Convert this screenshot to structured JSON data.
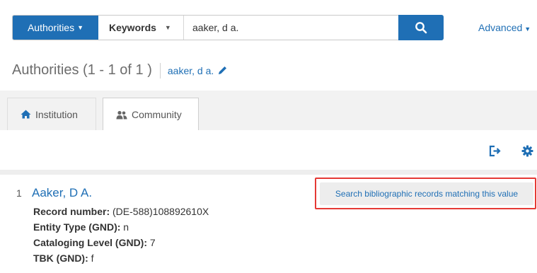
{
  "search": {
    "scope_label": "Authorities",
    "field_label": "Keywords",
    "query_value": "aaker, d a.",
    "advanced_label": "Advanced"
  },
  "results": {
    "title": "Authorities (1 - 1 of 1 )",
    "query_link": "aaker, d a."
  },
  "tabs": [
    {
      "label": "Institution",
      "icon": "home-icon",
      "active": false
    },
    {
      "label": "Community",
      "icon": "users-icon",
      "active": true
    }
  ],
  "toolbar": {
    "export_icon": "export-icon",
    "settings_icon": "gear-icon"
  },
  "records": [
    {
      "number": "1",
      "heading": "Aaker, D A.",
      "action_label": "Search bibliographic records matching this value",
      "fields": [
        {
          "label": "Record number:",
          "value": "(DE-588)108892610X"
        },
        {
          "label": "Entity Type (GND):",
          "value": "n"
        },
        {
          "label": "Cataloging Level (GND):",
          "value": "7"
        },
        {
          "label": "TBK (GND):",
          "value": "f"
        }
      ]
    }
  ],
  "colors": {
    "primary": "#1f6fb5",
    "highlight": "#e53935"
  }
}
